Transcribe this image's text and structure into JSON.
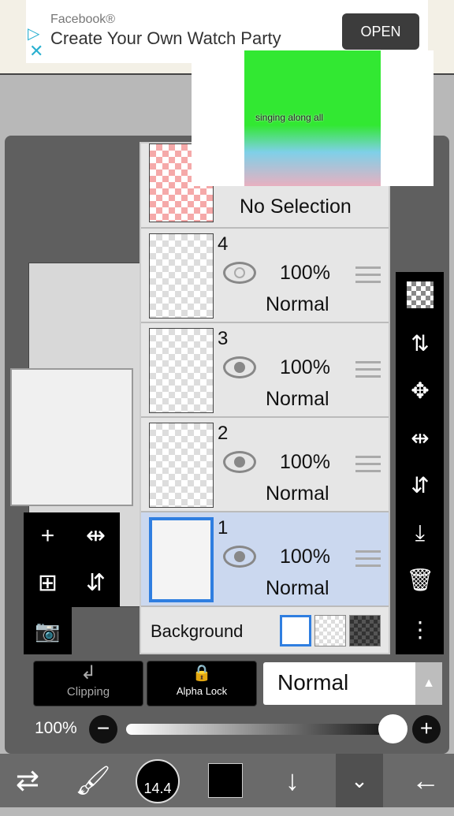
{
  "ad": {
    "brand": "Facebook®",
    "title": "Create Your Own Watch Party",
    "open_label": "OPEN",
    "video_caption": "singing along all"
  },
  "layers": {
    "top_partial": {
      "label": "No Selection"
    },
    "items": [
      {
        "number": "4",
        "opacity": "100%",
        "mode": "Normal",
        "visible": false
      },
      {
        "number": "3",
        "opacity": "100%",
        "mode": "Normal",
        "visible": true
      },
      {
        "number": "2",
        "opacity": "100%",
        "mode": "Normal",
        "visible": true
      },
      {
        "number": "1",
        "opacity": "100%",
        "mode": "Normal",
        "visible": true,
        "selected": true
      }
    ],
    "background_label": "Background"
  },
  "controls": {
    "clipping": "Clipping",
    "alpha_lock": "Alpha Lock",
    "blend_mode": "Normal",
    "opacity": "100%",
    "opacity_value": 100
  },
  "bottom": {
    "brush_size": "14.4",
    "color": "#000000"
  },
  "colors": {
    "selected_layer": "#cbd8ef",
    "accent": "#2f7ee0"
  }
}
